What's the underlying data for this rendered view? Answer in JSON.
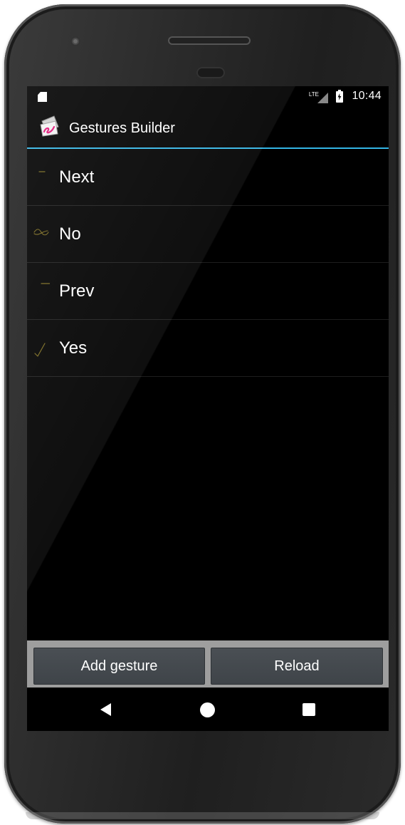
{
  "status_bar": {
    "network_type": "LTE",
    "time": "10:44",
    "icons": [
      "sd-card-icon",
      "signal-icon",
      "battery-charging-icon"
    ]
  },
  "action_bar": {
    "title": "Gestures Builder",
    "icon": "gestures-builder-app-icon"
  },
  "gestures": [
    {
      "name": "Next",
      "thumb": "short-horizontal-stroke"
    },
    {
      "name": "No",
      "thumb": "crossed-loop-stroke"
    },
    {
      "name": "Prev",
      "thumb": "short-horizontal-stroke"
    },
    {
      "name": "Yes",
      "thumb": "checkmark-stroke"
    }
  ],
  "buttons": {
    "add_label": "Add gesture",
    "reload_label": "Reload"
  },
  "nav_bar": {
    "icons": [
      "back-icon",
      "home-icon",
      "recents-icon"
    ]
  },
  "colors": {
    "accent": "#33b5e5",
    "screen_background": "#000000",
    "button_bar": "#9e9e9e",
    "button_face": "#44494e",
    "gesture_stroke": "#7a6a1e",
    "app_icon_accent": "#e0187a"
  }
}
